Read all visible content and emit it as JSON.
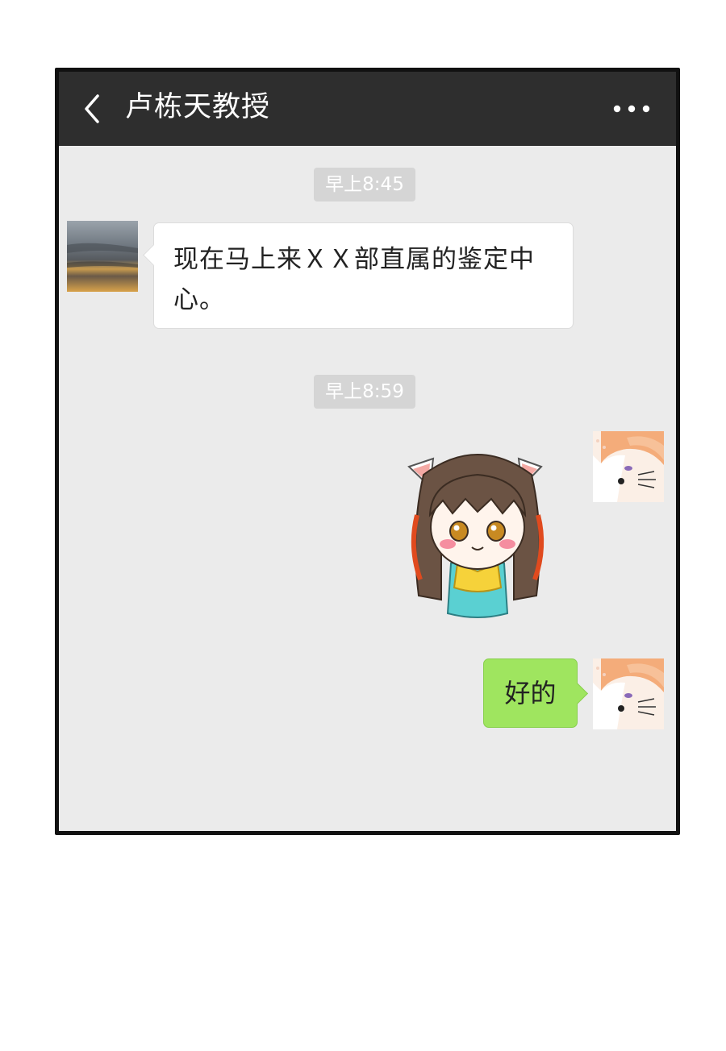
{
  "header": {
    "title": "卢栋天教授",
    "back_icon": "chevron-left-icon",
    "more_icon": "more-dots-icon"
  },
  "messages": [
    {
      "type": "timestamp",
      "text": "早上8:45"
    },
    {
      "type": "text",
      "sender": "contact",
      "text": "现在马上来ＸＸ部直属的鉴定中心。"
    },
    {
      "type": "timestamp",
      "text": "早上8:59"
    },
    {
      "type": "sticker",
      "sender": "me",
      "sticker": "chibi-girl-cat-ears"
    },
    {
      "type": "text",
      "sender": "me",
      "text": "好的"
    }
  ],
  "colors": {
    "nav_bg": "#2e2e2e",
    "chat_bg": "#ebebeb",
    "incoming_bubble": "#ffffff",
    "outgoing_bubble": "#9fe55f",
    "timestamp_bg": "#d5d5d5"
  }
}
